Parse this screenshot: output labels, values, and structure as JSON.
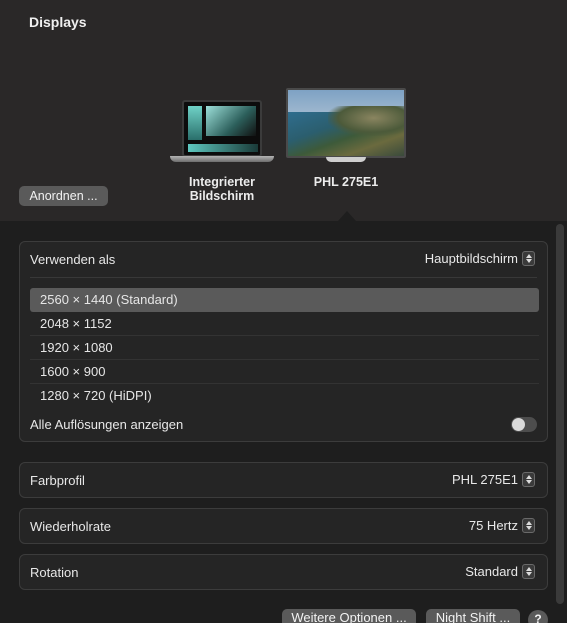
{
  "header": {
    "title": "Displays"
  },
  "arrange_button": {
    "label": "Anordnen ..."
  },
  "displays": [
    {
      "label": "Integrierter Bildschirm",
      "line1": "Integrierter",
      "line2": "Bildschirm"
    },
    {
      "label": "PHL 275E1"
    }
  ],
  "use_as": {
    "label": "Verwenden als",
    "value": "Hauptbildschirm"
  },
  "resolutions": [
    "2560 × 1440 (Standard)",
    "2048 × 1152",
    "1920 × 1080",
    "1600 × 900",
    "1280 × 720 (HiDPI)"
  ],
  "show_all": {
    "label": "Alle Auflösungen anzeigen",
    "enabled": false
  },
  "color_profile": {
    "label": "Farbprofil",
    "value": "PHL 275E1"
  },
  "refresh_rate": {
    "label": "Wiederholrate",
    "value": "75 Hertz"
  },
  "rotation": {
    "label": "Rotation",
    "value": "Standard"
  },
  "footer": {
    "more_options": "Weitere Optionen ...",
    "night_shift": "Night Shift ...",
    "help": "?"
  }
}
